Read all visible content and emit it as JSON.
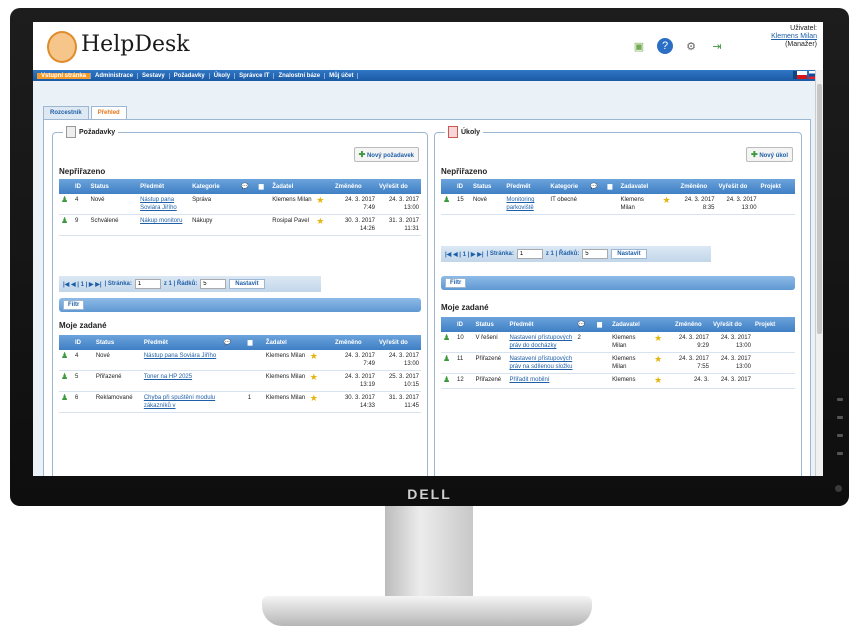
{
  "monitor": {
    "brand": "DELL"
  },
  "app": {
    "name": "HelpDesk",
    "user_label": "Uživatel:",
    "user_name": "Klemens Milan",
    "user_role": "(Manažer)"
  },
  "menu": [
    "Vstupní stránka",
    "Administrace",
    "Sestavy",
    "Požadavky",
    "Úkoly",
    "Správce IT",
    "Znalostní báze",
    "Můj účet"
  ],
  "tabs": [
    "Rozcestník",
    "Přehled"
  ],
  "requests": {
    "title": "Požadavky",
    "new_button": "Nový požadavek",
    "unassigned_title": "Nepřiřazeno",
    "mine_title": "Moje zadané",
    "columns": [
      "ID",
      "Status",
      "Předmět",
      "Kategorie",
      "Žadatel",
      "Změněno",
      "Vyřešit do"
    ],
    "mine_columns": [
      "ID",
      "Status",
      "Předmět",
      "Žadatel",
      "Změněno",
      "Vyřešit do"
    ],
    "unassigned_rows": [
      {
        "id": "4",
        "status": "Nové",
        "subject": "Nástup pana Soviára Jiřího",
        "category": "Správa",
        "requester": "Klemens Milan",
        "changed": "24. 3. 2017 7:49",
        "due": "24. 3. 2017 13:00"
      },
      {
        "id": "9",
        "status": "Schválené",
        "subject": "Nákup monitoru",
        "category": "Nákupy",
        "requester": "Rosipal Pavel",
        "changed": "30. 3. 2017 14:26",
        "due": "31. 3. 2017 11:31"
      }
    ],
    "mine_rows": [
      {
        "id": "4",
        "status": "Nové",
        "subject": "Nástup pana Soviára Jiřího",
        "count": "",
        "requester": "Klemens Milan",
        "changed": "24. 3. 2017 7:49",
        "due": "24. 3. 2017 13:00"
      },
      {
        "id": "5",
        "status": "Přiřazené",
        "subject": "Toner na HP 2025",
        "count": "",
        "requester": "Klemens Milan",
        "changed": "24. 3. 2017 13:19",
        "due": "25. 3. 2017 10:15"
      },
      {
        "id": "6",
        "status": "Reklamované",
        "subject": "Chyba při spuštění modulu zákazníků v",
        "count": "1",
        "requester": "Klemens Milan",
        "changed": "30. 3. 2017 14:33",
        "due": "31. 3. 2017 11:45"
      }
    ],
    "pager": {
      "page_label": "| Stránka:",
      "page_value": "1",
      "of_label": "z 1 | Řádků:",
      "rows_value": "5",
      "set_button": "Nastavit",
      "nav": "|◀ ◀ | 1 | ▶ ▶|"
    },
    "filter_button": "Filtr"
  },
  "tasks": {
    "title": "Úkoly",
    "new_button": "Nový úkol",
    "unassigned_title": "Nepřiřazeno",
    "mine_title": "Moje zadané",
    "columns": [
      "ID",
      "Status",
      "Předmět",
      "Kategorie",
      "Zadavatel",
      "Změněno",
      "Vyřešit do",
      "Projekt"
    ],
    "mine_columns": [
      "ID",
      "Status",
      "Předmět",
      "Zadavatel",
      "Změněno",
      "Vyřešit do",
      "Projekt"
    ],
    "unassigned_rows": [
      {
        "id": "15",
        "status": "Nové",
        "subject": "Monitoring parkoviště",
        "category": "IT obecné",
        "assigner": "Klemens Milan",
        "changed": "24. 3. 2017 8:35",
        "due": "24. 3. 2017 13:00",
        "project": ""
      }
    ],
    "mine_rows": [
      {
        "id": "10",
        "status": "V řešení",
        "subject": "Nastavení přístupových práv do docházky",
        "count": "2",
        "assigner": "Klemens Milan",
        "changed": "24. 3. 2017 9:29",
        "due": "24. 3. 2017 13:00"
      },
      {
        "id": "11",
        "status": "Přiřazené",
        "subject": "Nastavení přístupových práv na sdílenou složku",
        "count": "",
        "assigner": "Klemens Milan",
        "changed": "24. 3. 2017 7:55",
        "due": "24. 3. 2017 13:00"
      },
      {
        "id": "12",
        "status": "Přiřazené",
        "subject": "Přiřadit mobilní",
        "count": "",
        "assigner": "Klemens",
        "changed": "24. 3.",
        "due": "24. 3. 2017"
      }
    ],
    "pager": {
      "page_label": "| Stránka:",
      "page_value": "1",
      "of_label": "z 1 | Řádků:",
      "rows_value": "5",
      "set_button": "Nastavit",
      "nav": "|◀ ◀ | 1 | ▶ ▶|"
    },
    "filter_button": "Filtr"
  }
}
